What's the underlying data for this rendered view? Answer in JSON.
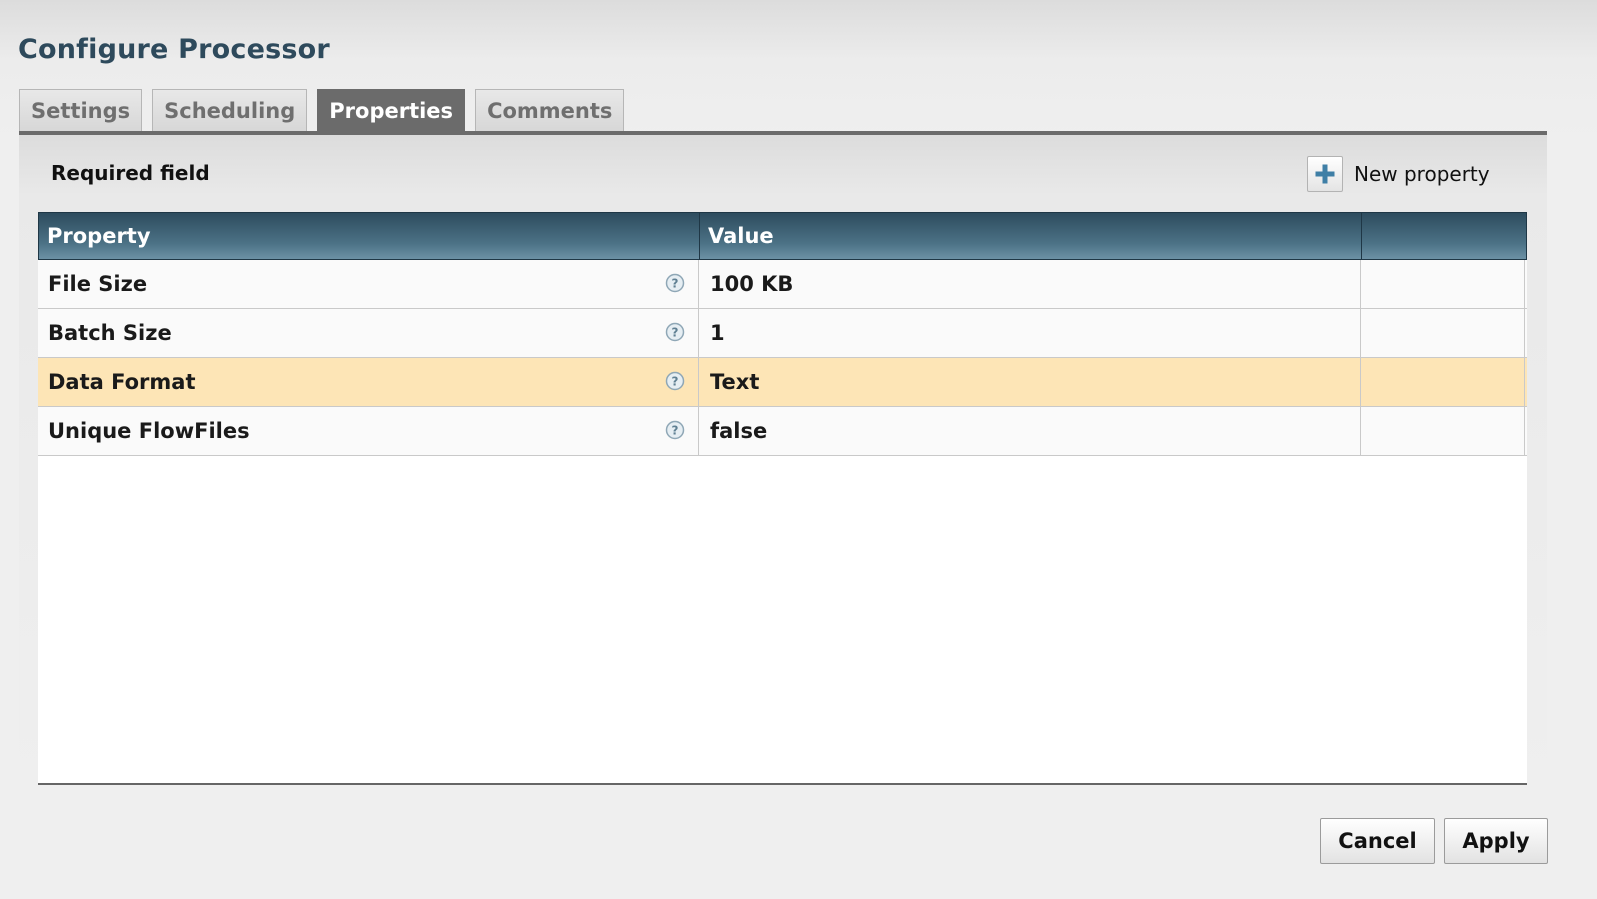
{
  "dialog": {
    "title": "Configure Processor"
  },
  "tabs": [
    {
      "label": "Settings",
      "active": false
    },
    {
      "label": "Scheduling",
      "active": false
    },
    {
      "label": "Properties",
      "active": true
    },
    {
      "label": "Comments",
      "active": false
    }
  ],
  "toolbar": {
    "required_label": "Required field",
    "new_property_label": "New property",
    "new_property_icon": "plus-icon"
  },
  "table": {
    "columns": [
      "Property",
      "Value",
      ""
    ],
    "help_icon": "help-icon",
    "rows": [
      {
        "name": "File Size",
        "value": "100 KB",
        "selected": false
      },
      {
        "name": "Batch Size",
        "value": "1",
        "selected": false
      },
      {
        "name": "Data Format",
        "value": "Text",
        "selected": true
      },
      {
        "name": "Unique FlowFiles",
        "value": "false",
        "selected": false
      }
    ]
  },
  "footer": {
    "cancel_label": "Cancel",
    "apply_label": "Apply"
  },
  "colors": {
    "title": "#2e4a5c",
    "header_bar": "#3f6377",
    "selected_row": "#fde5b6",
    "active_tab": "#6b6b6b"
  }
}
